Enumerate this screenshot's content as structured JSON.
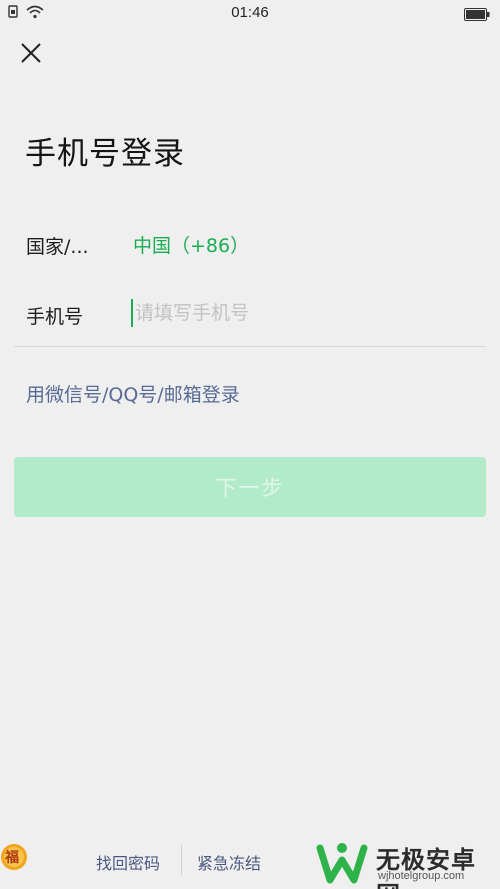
{
  "status_bar": {
    "time": "01:46",
    "icons": [
      "sim-icon",
      "wifi-icon",
      "battery-icon"
    ]
  },
  "header": {
    "close_icon": "close-icon"
  },
  "title": "手机号登录",
  "form": {
    "country_label": "国家/...",
    "country_value": "中国（+86）",
    "phone_label": "手机号",
    "phone_value": "",
    "phone_placeholder": "请填写手机号"
  },
  "alt_login_link": "用微信号/QQ号/邮箱登录",
  "next_button": "下一步",
  "footer": {
    "find_password": "找回密码",
    "emergency_freeze": "紧急冻结",
    "fu_badge": "福"
  },
  "watermark": {
    "title": "无极安卓网",
    "url": "wjhotelgroup.com"
  },
  "colors": {
    "background": "#efeff0",
    "accent_green": "#1aad52",
    "button_disabled": "#b2ebc9",
    "link_blue": "#586b95"
  }
}
